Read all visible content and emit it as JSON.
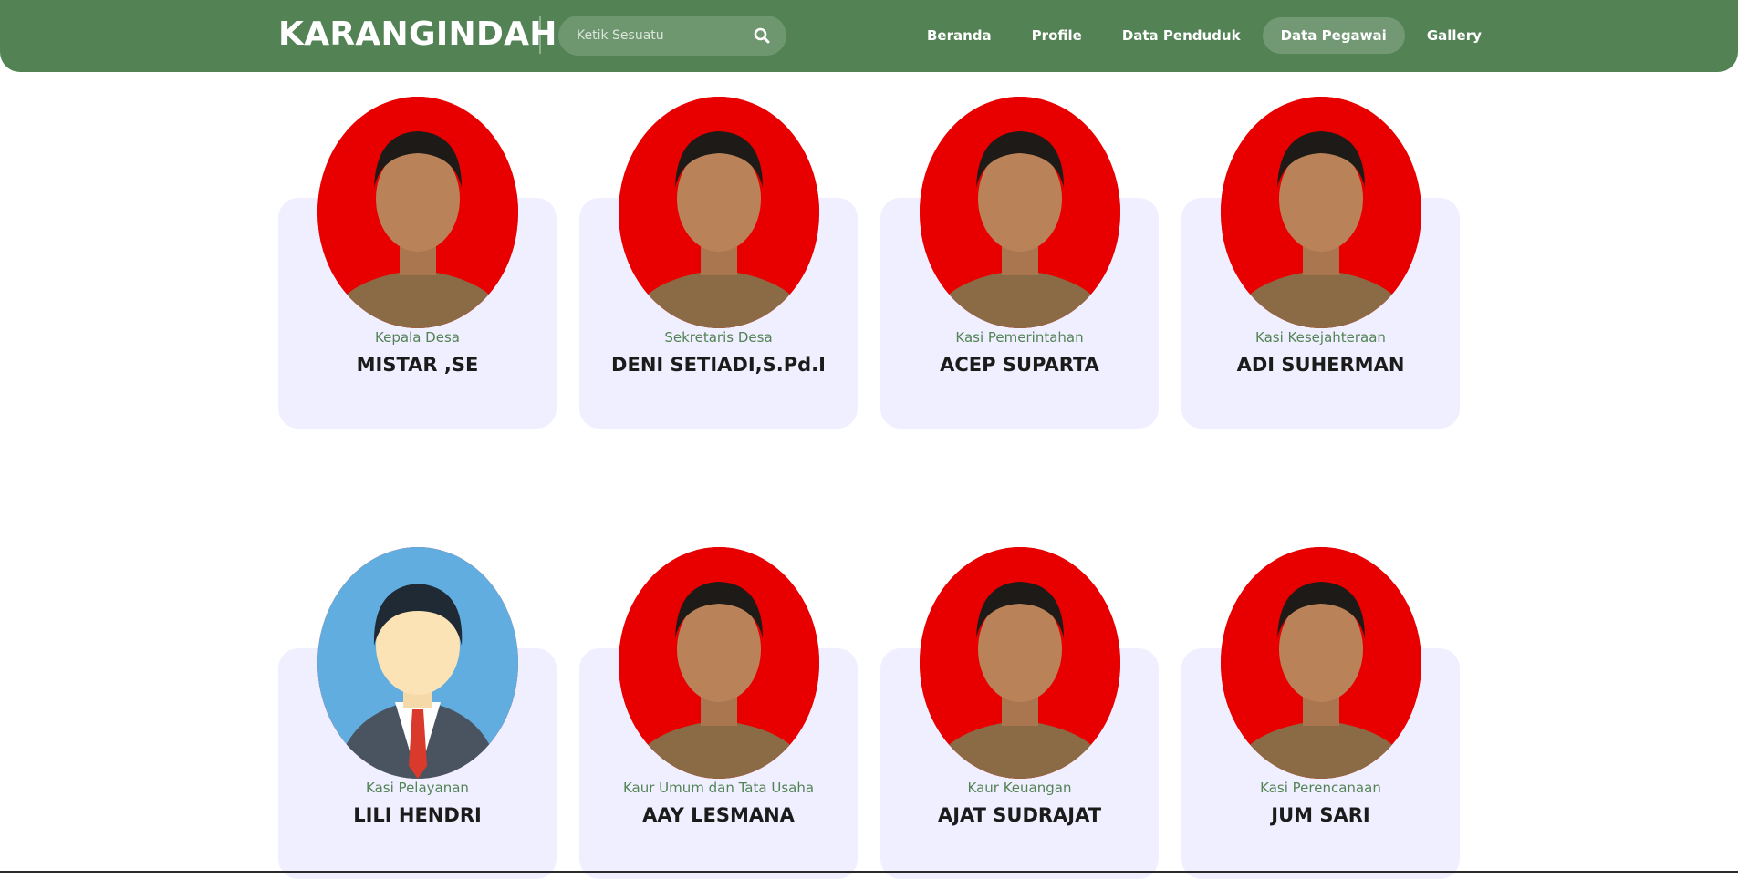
{
  "header": {
    "brand": "KARANGINDAH",
    "search": {
      "placeholder": "Ketik Sesuatu",
      "icon": "search-icon"
    },
    "nav": [
      {
        "label": "Beranda",
        "active": false
      },
      {
        "label": "Profile",
        "active": false
      },
      {
        "label": "Data Penduduk",
        "active": false
      },
      {
        "label": "Data Pegawai",
        "active": true
      },
      {
        "label": "Gallery",
        "active": false
      }
    ]
  },
  "colors": {
    "nav_bg": "#538355",
    "card_bg": "#f0efff",
    "role_text": "#538355",
    "photo_bg": "#e80000",
    "avatar_bg": "#62ade0"
  },
  "staff": [
    {
      "role": "Kepala Desa",
      "name": "MISTAR ,SE"
    },
    {
      "role": "Sekretaris Desa",
      "name": "DENI SETIADI,S.Pd.I"
    },
    {
      "role": "Kasi Pemerintahan",
      "name": "ACEP SUPARTA"
    },
    {
      "role": "Kasi Kesejahteraan",
      "name": "ADI SUHERMAN"
    },
    {
      "role": "Kasi Pelayanan",
      "name": "LILI HENDRI"
    },
    {
      "role": "Kaur Umum dan Tata Usaha",
      "name": "AAY LESMANA"
    },
    {
      "role": "Kaur Keuangan",
      "name": "AJAT SUDRAJAT"
    },
    {
      "role": "Kasi Perencanaan",
      "name": "JUM SARI"
    }
  ]
}
